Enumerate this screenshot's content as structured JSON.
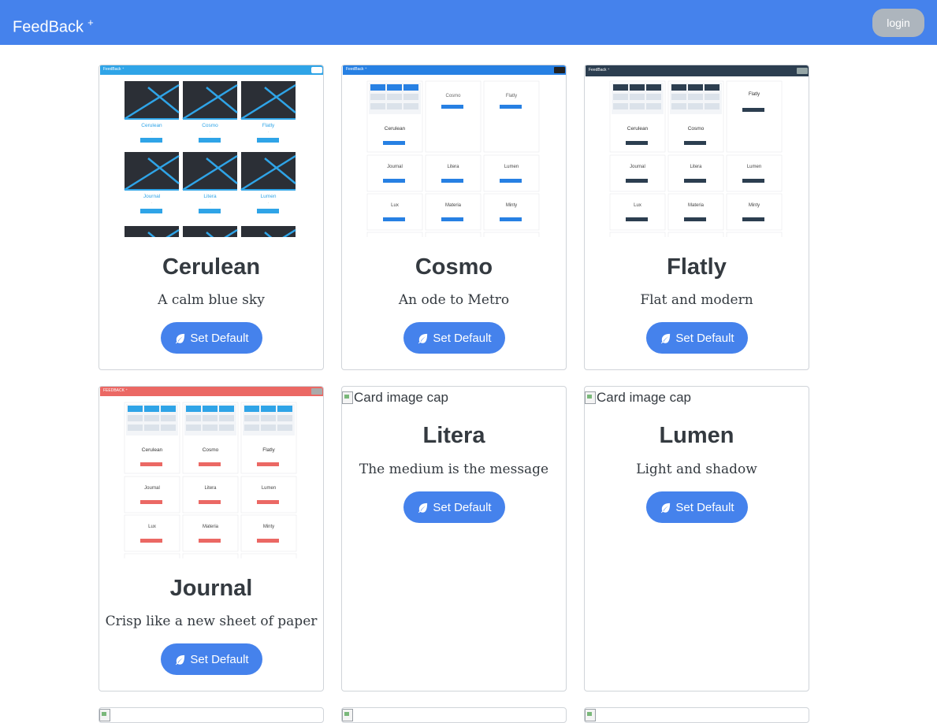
{
  "navbar": {
    "brand": "FeedBack",
    "brand_sup": "+",
    "login_label": "login"
  },
  "card_image_alt": "Card image cap",
  "set_default_label": "Set Default",
  "colors": {
    "primary": "#4582ec",
    "login_bg": "#adb5bd",
    "cosmo": "#2780e3",
    "flatly": "#2c3e50",
    "journal": "#eb6864",
    "cerulean": "#2fa4e7"
  },
  "themes": [
    {
      "name": "Cerulean",
      "description": "A calm blue sky"
    },
    {
      "name": "Cosmo",
      "description": "An ode to Metro"
    },
    {
      "name": "Flatly",
      "description": "Flat and modern"
    },
    {
      "name": "Journal",
      "description": "Crisp like a new sheet of paper"
    },
    {
      "name": "Litera",
      "description": "The medium is the message"
    },
    {
      "name": "Lumen",
      "description": "Light and shadow"
    }
  ]
}
